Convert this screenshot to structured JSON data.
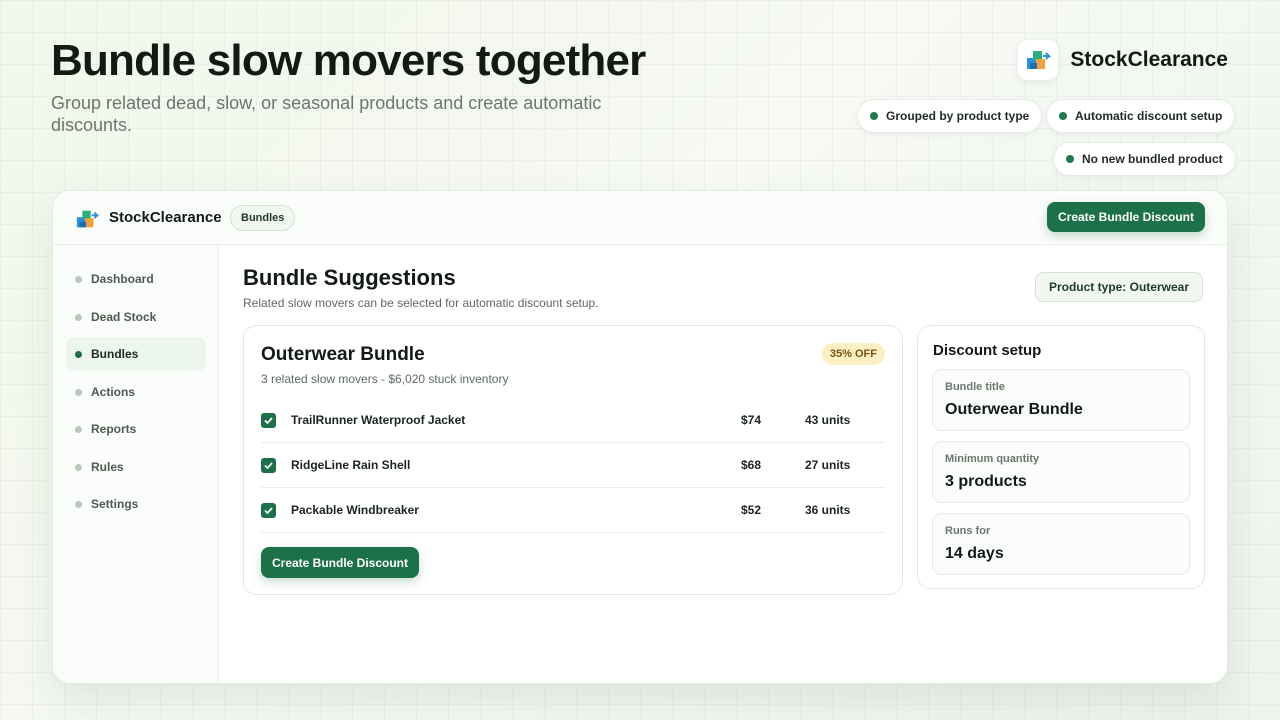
{
  "hero": {
    "title": "Bundle slow movers together",
    "subtitle": "Group related dead, slow, or seasonal products and create automatic discounts."
  },
  "brand": {
    "name": "StockClearance",
    "logo_icon": "stacked-boxes-icon"
  },
  "feature_pills": [
    {
      "label": "Grouped by product type"
    },
    {
      "label": "Automatic discount setup"
    },
    {
      "label": "No new bundled product"
    }
  ],
  "app": {
    "topbar": {
      "app_name": "StockClearance",
      "breadcrumb": "Bundles",
      "primary_button": "Create Bundle Discount"
    },
    "sidebar": {
      "items": [
        {
          "label": "Dashboard",
          "active": false
        },
        {
          "label": "Dead Stock",
          "active": false
        },
        {
          "label": "Bundles",
          "active": true
        },
        {
          "label": "Actions",
          "active": false
        },
        {
          "label": "Reports",
          "active": false
        },
        {
          "label": "Rules",
          "active": false
        },
        {
          "label": "Settings",
          "active": false
        }
      ]
    },
    "main": {
      "title": "Bundle Suggestions",
      "subtitle": "Related slow movers can be selected for automatic discount setup.",
      "filter": "Product type: Outerwear",
      "bundle": {
        "title": "Outerwear Bundle",
        "meta": "3 related slow movers - $6,020 stuck inventory",
        "discount_badge": "35% OFF",
        "items": [
          {
            "name": "TrailRunner Waterproof Jacket",
            "price": "$74",
            "units": "43 units",
            "checked": true
          },
          {
            "name": "RidgeLine Rain Shell",
            "price": "$68",
            "units": "27 units",
            "checked": true
          },
          {
            "name": "Packable Windbreaker",
            "price": "$52",
            "units": "36 units",
            "checked": true
          }
        ],
        "button": "Create Bundle Discount"
      },
      "setup": {
        "title": "Discount setup",
        "fields": [
          {
            "label": "Bundle title",
            "value": "Outerwear Bundle"
          },
          {
            "label": "Minimum quantity",
            "value": "3 products"
          },
          {
            "label": "Runs for",
            "value": "14 days"
          }
        ]
      }
    }
  },
  "colors": {
    "accent": "#1d7148",
    "badge_bg": "#fcefc4",
    "badge_text": "#7a5410"
  }
}
